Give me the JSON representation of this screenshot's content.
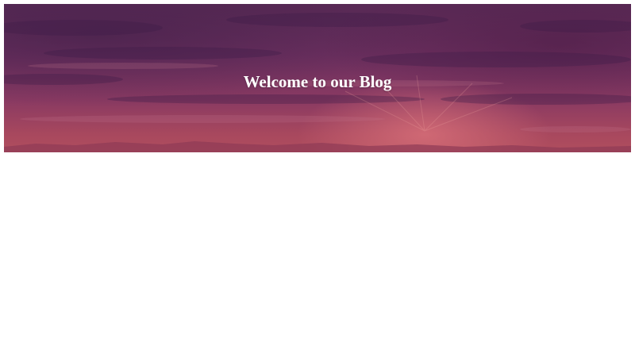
{
  "hero": {
    "title": "Welcome to our Blog",
    "background_description": "sunset-sky-image",
    "colors": {
      "sky_top": "#5a2a56",
      "sky_mid": "#8a3a62",
      "sky_bottom": "#b04e5e",
      "title_text": "#ffffff"
    }
  },
  "page": {
    "background": "#ffffff"
  }
}
